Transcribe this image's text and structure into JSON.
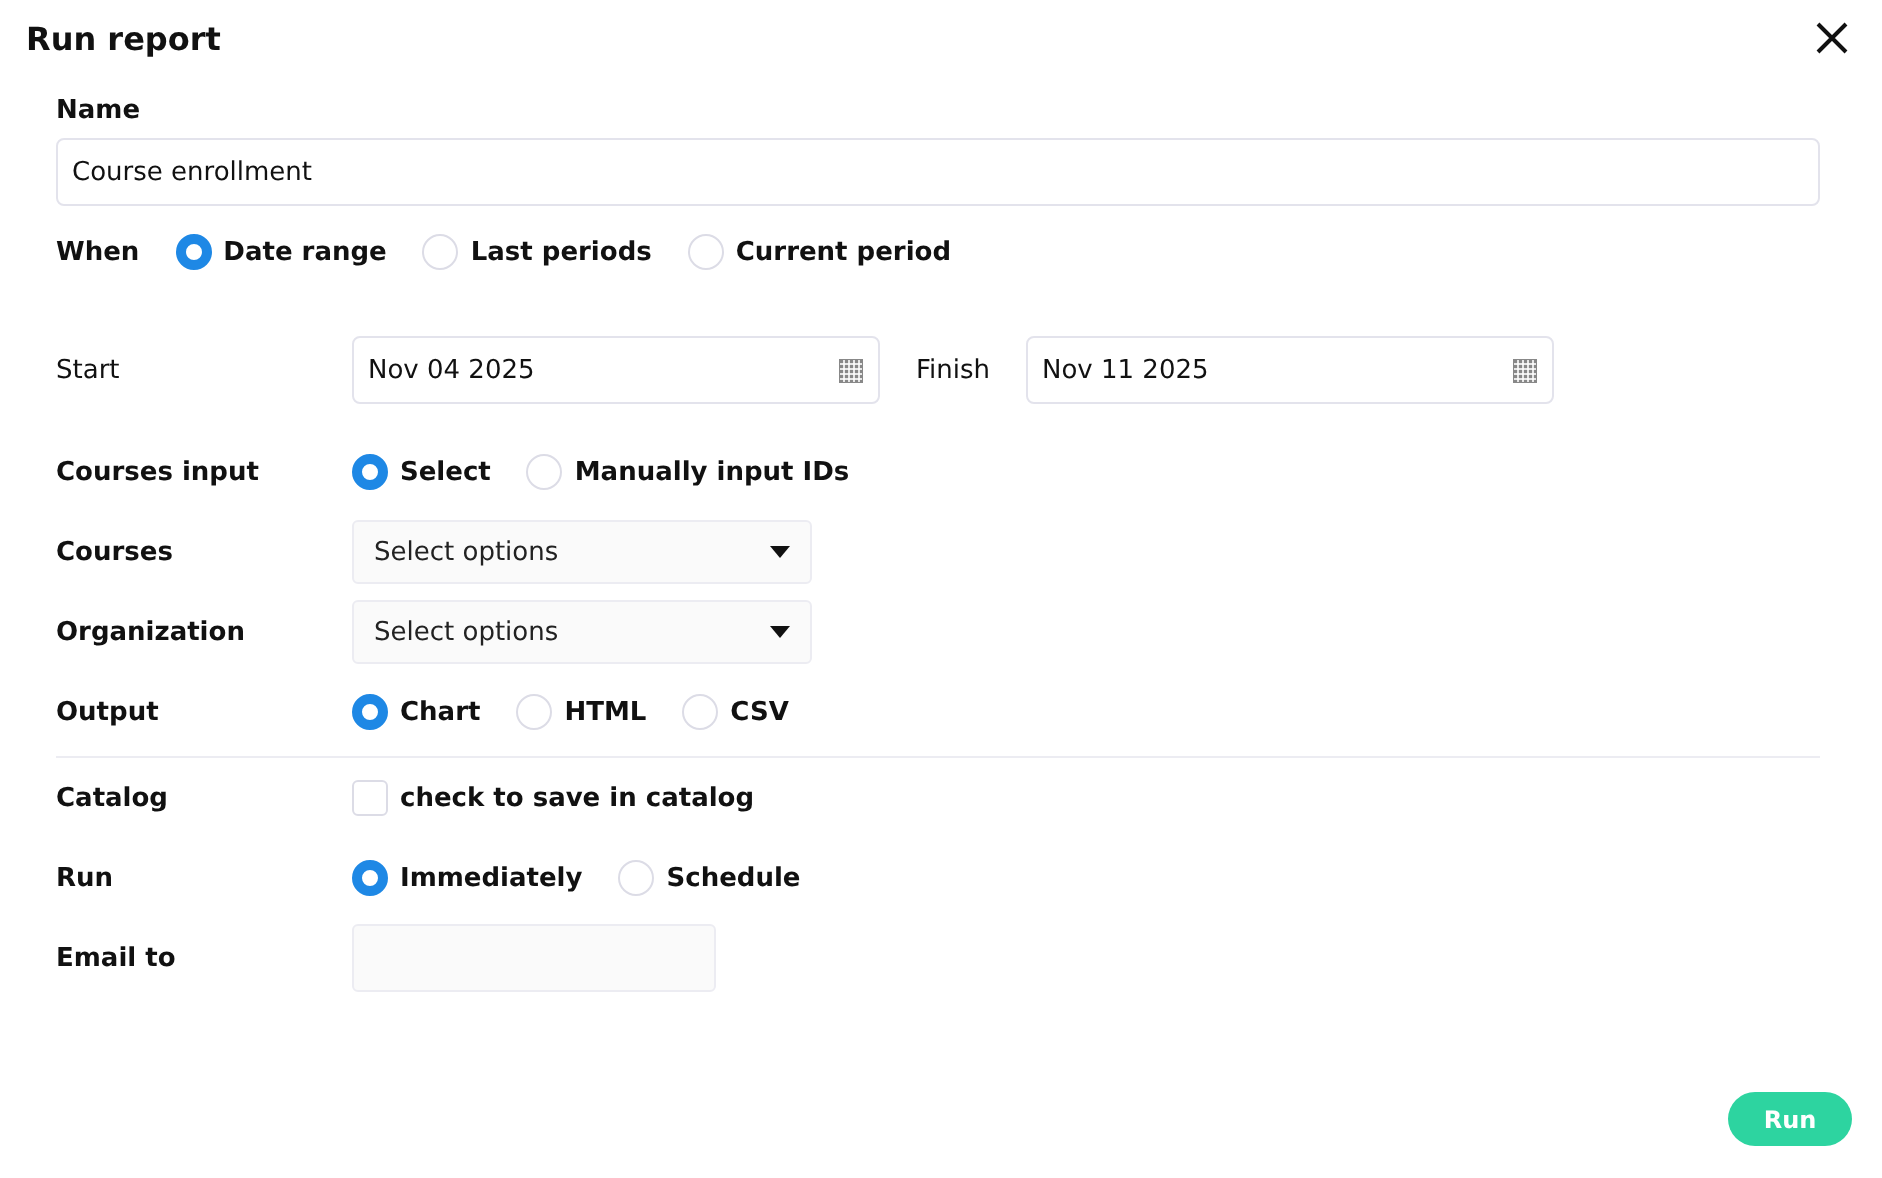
{
  "title": "Run report",
  "name": {
    "label": "Name",
    "value": "Course enrollment"
  },
  "when": {
    "label": "When",
    "options": [
      {
        "label": "Date range",
        "selected": true
      },
      {
        "label": "Last periods",
        "selected": false
      },
      {
        "label": "Current period",
        "selected": false
      }
    ]
  },
  "dates": {
    "start": {
      "label": "Start",
      "value": "Nov 04 2025"
    },
    "finish": {
      "label": "Finish",
      "value": "Nov 11 2025"
    }
  },
  "rows": [
    {
      "kind": "radio",
      "label": "Courses input",
      "options": [
        {
          "label": "Select",
          "selected": true
        },
        {
          "label": "Manually input IDs",
          "selected": false
        }
      ]
    },
    {
      "kind": "select",
      "label": "Courses",
      "placeholder": "Select options"
    },
    {
      "kind": "select",
      "label": "Organization",
      "placeholder": "Select options"
    },
    {
      "kind": "radio",
      "label": "Output",
      "options": [
        {
          "label": "Chart",
          "selected": true
        },
        {
          "label": "HTML",
          "selected": false
        },
        {
          "label": "CSV",
          "selected": false
        }
      ]
    },
    {
      "kind": "divider"
    },
    {
      "kind": "checkbox",
      "label": "Catalog",
      "text": "check to save in catalog",
      "checked": false
    },
    {
      "kind": "radio",
      "label": "Run",
      "options": [
        {
          "label": "Immediately",
          "selected": true
        },
        {
          "label": "Schedule",
          "selected": false
        }
      ]
    },
    {
      "kind": "input",
      "label": "Email to"
    }
  ],
  "run_button": "Run"
}
